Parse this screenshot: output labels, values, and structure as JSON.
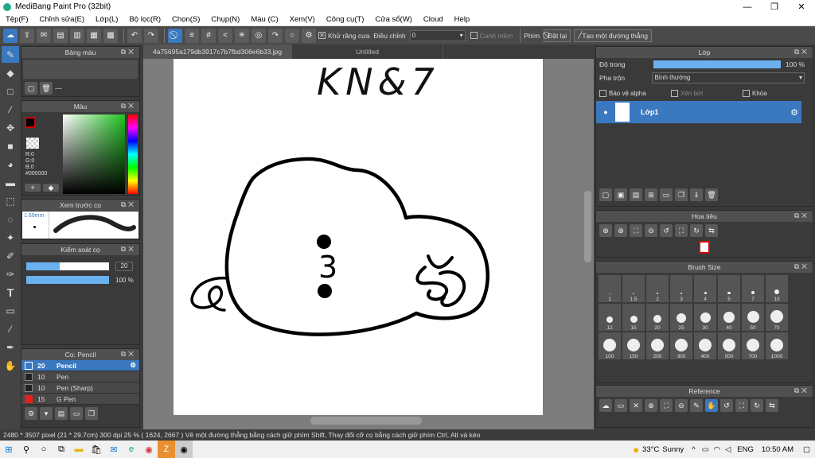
{
  "app": {
    "title": "MediBang Paint Pro (32bit)"
  },
  "window": {
    "minimize": "—",
    "maximize": "❐",
    "close": "✕"
  },
  "menu": [
    "Tệp(F)",
    "Chỉnh sửa(E)",
    "Lớp(L)",
    "Bộ lọc(R)",
    "Chọn(S)",
    "Chụp(N)",
    "Màu (C)",
    "Xem(V)",
    "Công cụ(T)",
    "Cửa sổ(W)",
    "Cloud",
    "Help"
  ],
  "toolbar": {
    "antialias": "Khử răng cưa",
    "adjust_label": "Điều chỉnh",
    "adjust_value": "0",
    "smooth": "Canh mềm",
    "key_label": "Phím",
    "reset": "Đặt lại",
    "line": "Tạo một đường thẳng"
  },
  "tabs": {
    "file": "4a75695a179db3917c7b7fbd306e6b33.jpg",
    "untitled": "Untitled"
  },
  "panels": {
    "palette": "Bảng màu",
    "palette_value": "---",
    "color": "Màu",
    "rgb": {
      "r": "R:0",
      "g": "G:0",
      "b": "B:0",
      "hex": "#000000"
    },
    "brush_preview": "Xem trước cọ",
    "brush_preview_size": "1.69mm",
    "brush_control": "Kiểm soát cọ",
    "size_value": "20",
    "opacity_value": "100 %",
    "brushes_title": "Cọ: Pencil",
    "brushes": [
      {
        "size": "20",
        "name": "Pencil",
        "color": "#3a78c0",
        "active": true
      },
      {
        "size": "10",
        "name": "Pen",
        "color": "#222222",
        "active": false
      },
      {
        "size": "10",
        "name": "Pen (Sharp)",
        "color": "#222222",
        "active": false
      },
      {
        "size": "15",
        "name": "G Pen",
        "color": "#e02020",
        "active": false
      }
    ]
  },
  "layers": {
    "title": "Lớp",
    "opacity_label": "Độ trong",
    "opacity_value": "100 %",
    "blend_label": "Pha trộn",
    "blend_value": "Bình thường",
    "protect_alpha": "Bảo vệ alpha",
    "clip": "Xén bớt",
    "lock": "Khóa",
    "layer_name": "Lớp1"
  },
  "navigator": {
    "title": "Hoa tiêu"
  },
  "brush_size": {
    "title": "Brush Size",
    "sizes": [
      "1",
      "1.5",
      "2",
      "3",
      "4",
      "5",
      "7",
      "10",
      "12",
      "15",
      "20",
      "25",
      "30",
      "40",
      "50",
      "70",
      "100",
      "150",
      "200",
      "300",
      "400",
      "500",
      "700",
      "1000"
    ]
  },
  "reference": {
    "title": "Reference"
  },
  "canvas": {
    "text": "KN&7"
  },
  "status": "2480 * 3507 pixel  (21 * 29.7cm)  300 dpi  25 %  ( 1624, 2667 )  Vẽ một đường thẳng bằng cách giữ phím Shift, Thay đổi cỡ cọ bằng cách giữ phím Ctrl, Alt và kéo",
  "taskbar": {
    "temp": "33°C",
    "weather": "Sunny",
    "lang": "ENG",
    "time": "10:50 AM"
  }
}
